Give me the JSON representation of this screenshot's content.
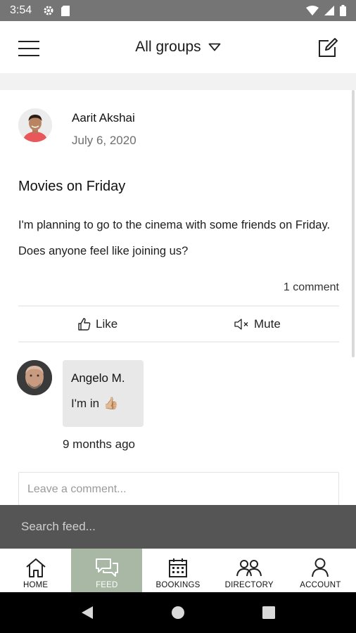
{
  "status_bar": {
    "time": "3:54"
  },
  "header": {
    "title": "All groups"
  },
  "post": {
    "author": "Aarit Akshai",
    "date": "July 6, 2020",
    "title": "Movies on Friday",
    "body": "I'm planning to go to the cinema with some friends on Friday. Does anyone feel like joining us?",
    "comment_count": "1 comment",
    "like_label": "Like",
    "mute_label": "Mute"
  },
  "comment": {
    "author": "Angelo M.",
    "text": "I'm in",
    "emoji": "👍🏼",
    "time": "9 months ago"
  },
  "comment_input": {
    "placeholder": "Leave a comment..."
  },
  "search": {
    "placeholder": "Search feed..."
  },
  "nav": {
    "items": [
      {
        "label": "HOME",
        "icon": "home-icon"
      },
      {
        "label": "FEED",
        "icon": "feed-icon",
        "active": true
      },
      {
        "label": "BOOKINGS",
        "icon": "calendar-icon"
      },
      {
        "label": "DIRECTORY",
        "icon": "people-icon"
      },
      {
        "label": "ACCOUNT",
        "icon": "person-icon"
      }
    ]
  },
  "colors": {
    "active_nav": "#a8b8a5",
    "search_bar": "#555555",
    "status_bar": "#757575"
  }
}
